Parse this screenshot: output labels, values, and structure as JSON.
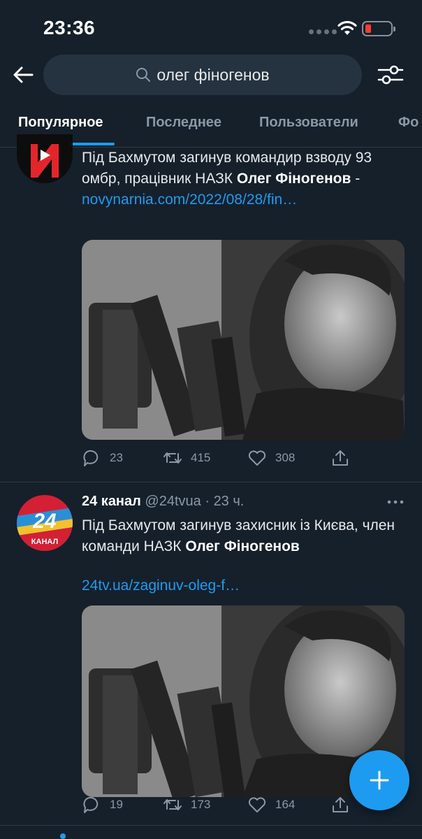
{
  "status_bar": {
    "time": "23:36"
  },
  "search": {
    "query": "олег фіногенов"
  },
  "tabs": [
    {
      "label": "Популярное",
      "active": true
    },
    {
      "label": "Последнее",
      "active": false
    },
    {
      "label": "Пользователи",
      "active": false
    },
    {
      "label": "Фо",
      "active": false
    }
  ],
  "tweets": [
    {
      "text_plain": "Під Бахмутом загинув командир взводу 93 омбр, працівник НАЗК",
      "text_bold": "Олег Фіногенов",
      "text_sep": " - ",
      "link": "novynarnia.com/2022/08/28/fin…",
      "replies": "23",
      "retweets": "415",
      "likes": "308"
    },
    {
      "author_name": "24 канал",
      "author_handle": "@24tvua",
      "dot": "·",
      "time": "23 ч.",
      "text_plain": "Під Бахмутом загинув захисник із Києва, член команди НАЗК",
      "text_bold": "Олег Фіногенов",
      "link": "24tv.ua/zaginuv-oleg-f…",
      "avatar_big": "24",
      "avatar_small": "КАНАЛ",
      "replies": "19",
      "retweets": "173",
      "likes": "164"
    }
  ],
  "colors": {
    "background": "#15202b",
    "accent": "#1d9bf0",
    "muted": "#8b98a5"
  }
}
